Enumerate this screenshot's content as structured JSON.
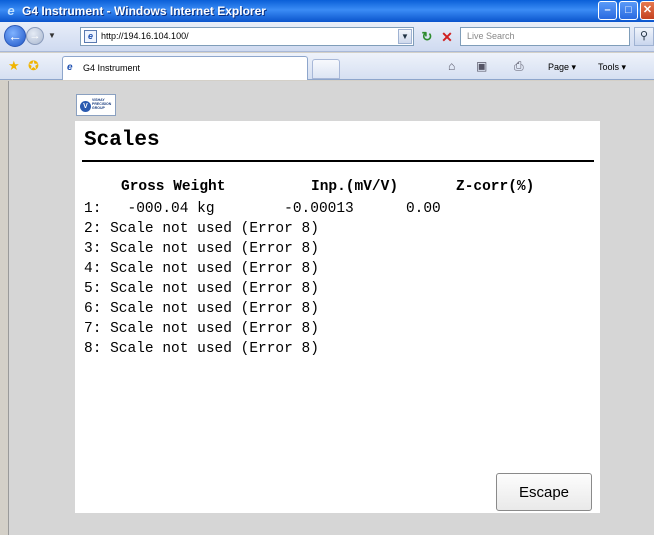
{
  "window": {
    "title": "G4 Instrument - Windows Internet Explorer",
    "buttons": {
      "minimize": "–",
      "maximize": "□",
      "close": "✕"
    }
  },
  "browser": {
    "address": "http://194.16.104.100/",
    "search_placeholder": "Live Search",
    "tab_label": "G4 Instrument",
    "toolbar": {
      "page_label": "Page",
      "tools_label": "Tools"
    }
  },
  "logo": {
    "text": "VISHAY PRECISION GROUP",
    "mark": "V"
  },
  "page": {
    "title": "Scales",
    "headers": {
      "gross": "Gross Weight",
      "inp": "Inp.(mV/V)",
      "zcorr": "Z-corr(%)"
    },
    "rows": [
      "1:   -000.04 kg        -0.00013      0.00",
      "2: Scale not used (Error 8)",
      "3: Scale not used (Error 8)",
      "4: Scale not used (Error 8)",
      "5: Scale not used (Error 8)",
      "6: Scale not used (Error 8)",
      "7: Scale not used (Error 8)",
      "8: Scale not used (Error 8)"
    ],
    "escape_label": "Escape"
  },
  "colors": {
    "titlebar": "#0a5fd8",
    "panel_bg": "#ffffff",
    "page_bg": "#d6d6d6"
  }
}
